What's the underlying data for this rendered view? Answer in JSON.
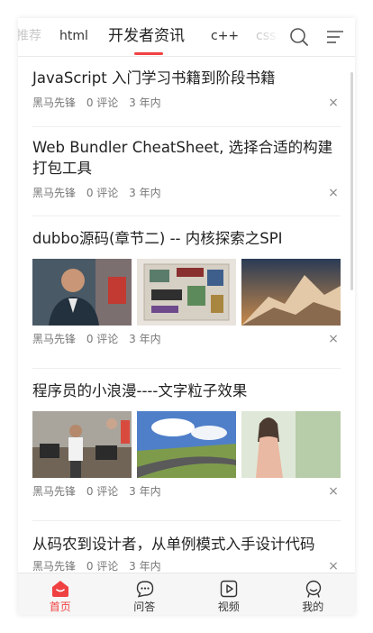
{
  "tabs": [
    {
      "label": "推荐"
    },
    {
      "label": "html"
    },
    {
      "label": "开发者资讯"
    },
    {
      "label": "c++"
    },
    {
      "label": "css"
    }
  ],
  "active_tab": "开发者资讯",
  "accent_color": "#f04142",
  "header_icons": {
    "search": "search-icon",
    "menu": "menu-lines-icon"
  },
  "articles": [
    {
      "title": "JavaScript 入门学习书籍到阶段书籍",
      "author": "黑马先锋",
      "comments": "0 评论",
      "time": "3 年内"
    },
    {
      "title": "Web Bundler CheatSheet, 选择合适的构建打包工具",
      "author": "黑马先锋",
      "comments": "0 评论",
      "time": "3 年内"
    },
    {
      "title": "dubbo源码(章节二) -- 内核探索之SPI",
      "author": "黑马先锋",
      "comments": "0 评论",
      "time": "3 年内"
    },
    {
      "title": "程序员的小浪漫----文字粒子效果",
      "author": "黑马先锋",
      "comments": "0 评论",
      "time": "3 年内"
    },
    {
      "title": "从码农到设计者，从单例模式入手设计代码",
      "author": "黑马先锋",
      "comments": "0 评论",
      "time": "3 年内"
    }
  ],
  "close_glyph": "×",
  "bottom_nav": [
    {
      "label": "首页",
      "icon": "home-icon"
    },
    {
      "label": "问答",
      "icon": "chat-bubble-icon"
    },
    {
      "label": "视频",
      "icon": "video-play-icon"
    },
    {
      "label": "我的",
      "icon": "profile-face-icon"
    }
  ]
}
